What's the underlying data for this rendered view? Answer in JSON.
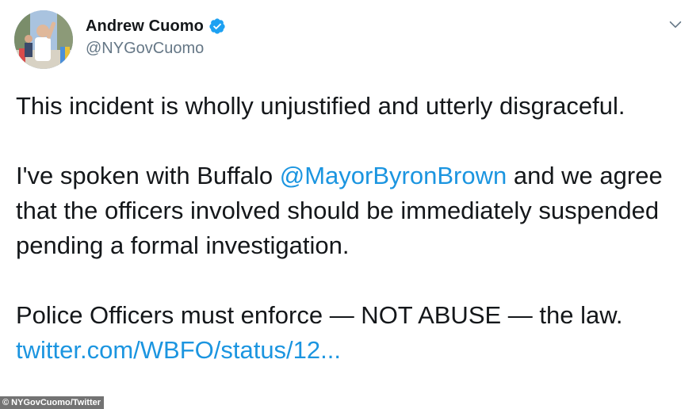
{
  "user": {
    "display_name": "Andrew Cuomo",
    "handle": "@NYGovCuomo",
    "verified": true
  },
  "tweet": {
    "para1": "This incident is wholly unjustified and utterly disgraceful.",
    "para2_pre": "I've spoken with Buffalo ",
    "para2_mention": "@MayorByronBrown",
    "para2_post": " and we agree that the officers involved should be immediately suspended pending a formal investigation.",
    "para3": "Police Officers must enforce — NOT ABUSE — the law.",
    "link": "twitter.com/WBFO/status/12..."
  },
  "photo_credit": "© NYGovCuomo/Twitter",
  "colors": {
    "link": "#1b95e0",
    "text": "#14171a",
    "muted": "#657786",
    "verified_badge": "#1da1f2"
  },
  "icons": {
    "verified": "verified-badge-icon",
    "menu": "chevron-down-icon"
  }
}
